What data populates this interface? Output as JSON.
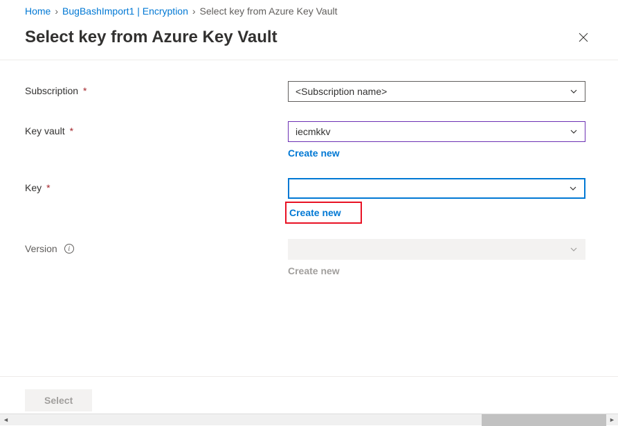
{
  "breadcrumb": {
    "home": "Home",
    "mid": "BugBashImport1 | Encryption",
    "current": "Select key from Azure Key Vault"
  },
  "header": {
    "title": "Select key from Azure Key Vault"
  },
  "fields": {
    "subscription": {
      "label": "Subscription",
      "required": "*",
      "value": "<Subscription name>"
    },
    "keyvault": {
      "label": "Key vault",
      "required": "*",
      "value": "iecmkkv",
      "create": "Create new"
    },
    "key": {
      "label": "Key",
      "required": "*",
      "value": "",
      "create": "Create new"
    },
    "version": {
      "label": "Version",
      "value": "",
      "create": "Create new"
    }
  },
  "footer": {
    "select": "Select"
  }
}
